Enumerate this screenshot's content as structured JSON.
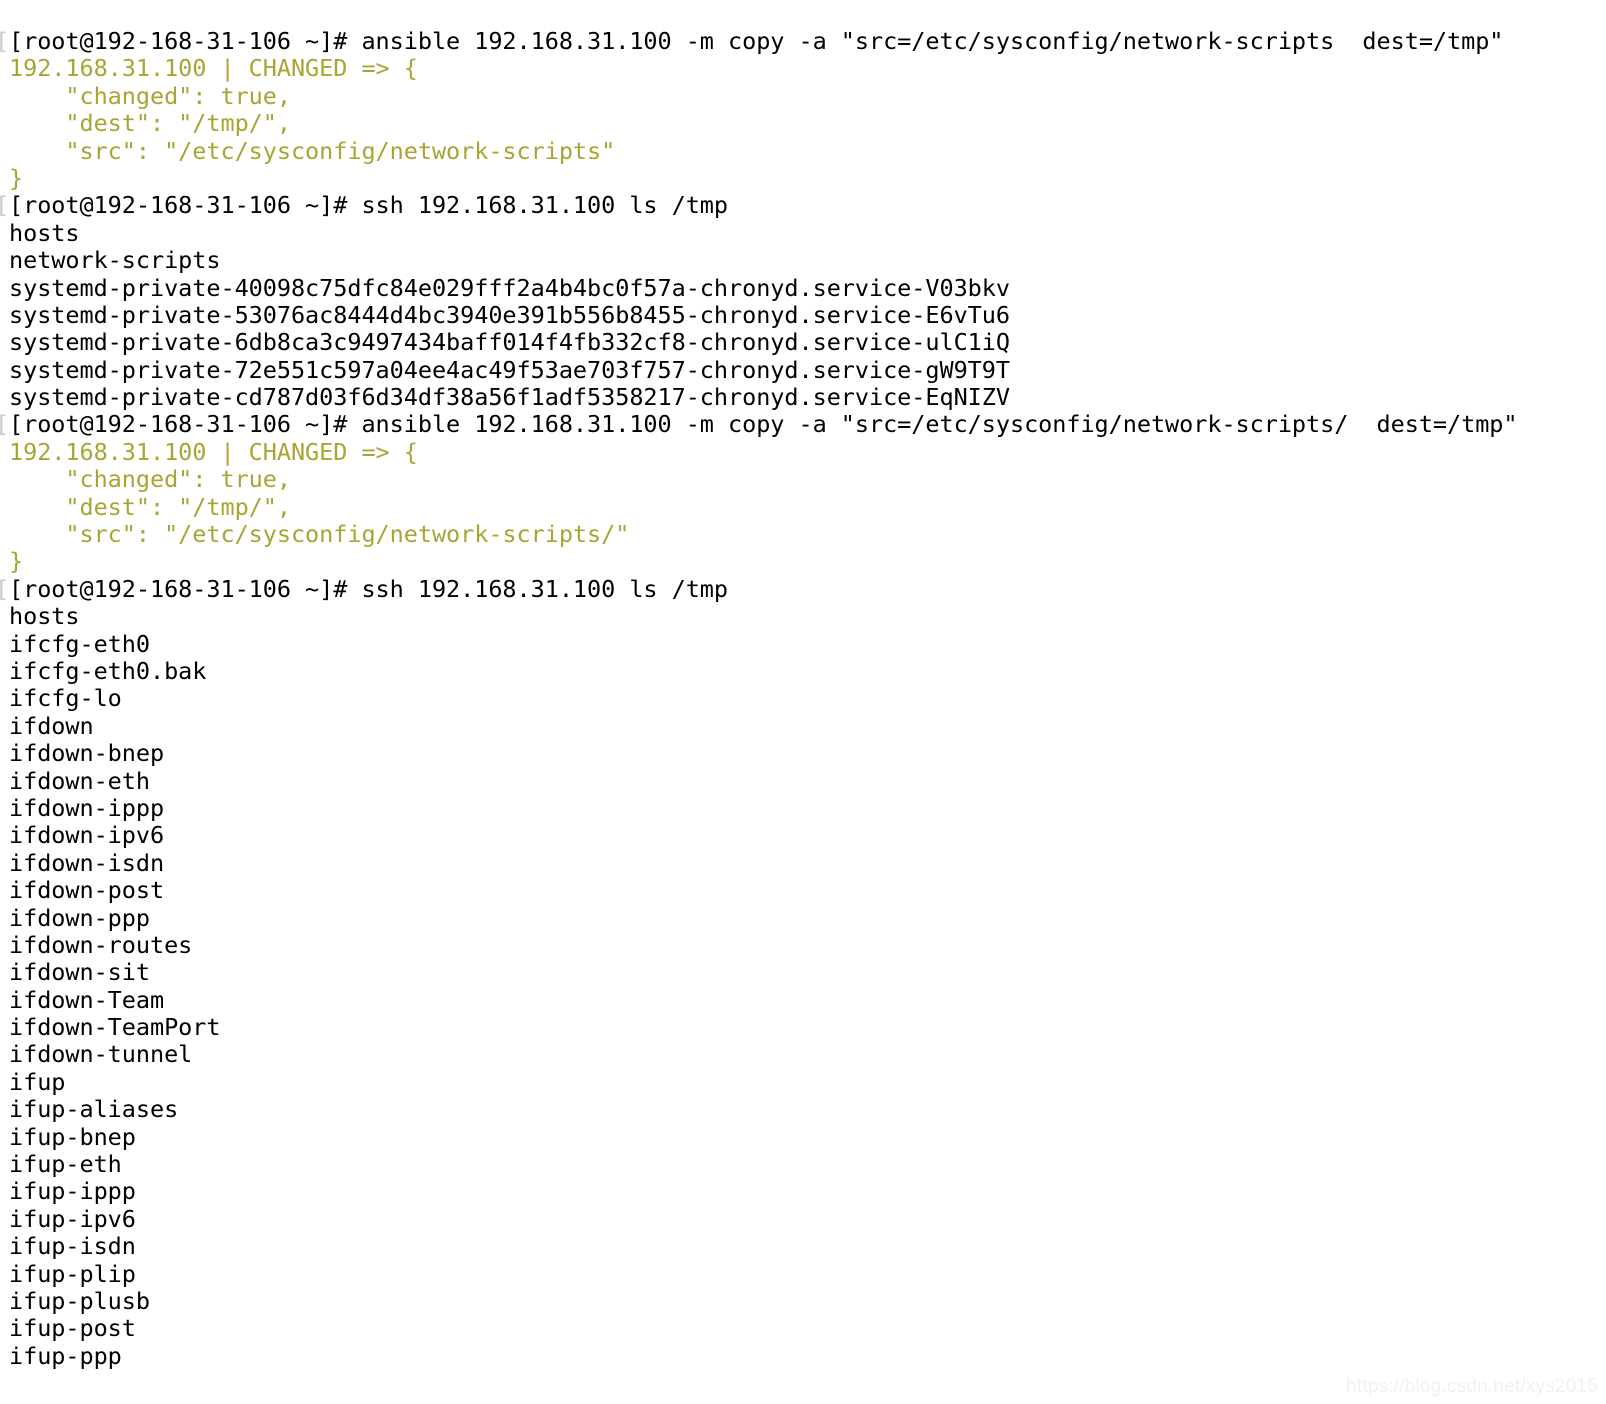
{
  "terminal": {
    "background_color": "#ffffff",
    "default_text_color": "#000000",
    "output_accent_color": "#a9a534",
    "watermark": "https://blog.csdn.net/xys2015",
    "lines": [
      {
        "kind": "prompt",
        "text": "[root@192-168-31-106 ~]# ansible 192.168.31.100 -m copy -a \"src=/etc/sysconfig/network-scripts  dest=/tmp\""
      },
      {
        "kind": "json",
        "text": "192.168.31.100 | CHANGED => {"
      },
      {
        "kind": "json",
        "text": "    \"changed\": true,"
      },
      {
        "kind": "json",
        "text": "    \"dest\": \"/tmp/\","
      },
      {
        "kind": "json",
        "text": "    \"src\": \"/etc/sysconfig/network-scripts\""
      },
      {
        "kind": "json",
        "text": "}"
      },
      {
        "kind": "prompt",
        "text": "[root@192-168-31-106 ~]# ssh 192.168.31.100 ls /tmp"
      },
      {
        "kind": "out",
        "text": "hosts"
      },
      {
        "kind": "out",
        "text": "network-scripts"
      },
      {
        "kind": "out",
        "text": "systemd-private-40098c75dfc84e029fff2a4b4bc0f57a-chronyd.service-V03bkv"
      },
      {
        "kind": "out",
        "text": "systemd-private-53076ac8444d4bc3940e391b556b8455-chronyd.service-E6vTu6"
      },
      {
        "kind": "out",
        "text": "systemd-private-6db8ca3c9497434baff014f4fb332cf8-chronyd.service-ulC1iQ"
      },
      {
        "kind": "out",
        "text": "systemd-private-72e551c597a04ee4ac49f53ae703f757-chronyd.service-gW9T9T"
      },
      {
        "kind": "out",
        "text": "systemd-private-cd787d03f6d34df38a56f1adf5358217-chronyd.service-EqNIZV"
      },
      {
        "kind": "prompt",
        "text": "[root@192-168-31-106 ~]# ansible 192.168.31.100 -m copy -a \"src=/etc/sysconfig/network-scripts/  dest=/tmp\""
      },
      {
        "kind": "json",
        "text": "192.168.31.100 | CHANGED => {"
      },
      {
        "kind": "json",
        "text": "    \"changed\": true,"
      },
      {
        "kind": "json",
        "text": "    \"dest\": \"/tmp/\","
      },
      {
        "kind": "json",
        "text": "    \"src\": \"/etc/sysconfig/network-scripts/\""
      },
      {
        "kind": "json",
        "text": "}"
      },
      {
        "kind": "prompt",
        "text": "[root@192-168-31-106 ~]# ssh 192.168.31.100 ls /tmp"
      },
      {
        "kind": "out",
        "text": "hosts"
      },
      {
        "kind": "out",
        "text": "ifcfg-eth0"
      },
      {
        "kind": "out",
        "text": "ifcfg-eth0.bak"
      },
      {
        "kind": "out",
        "text": "ifcfg-lo"
      },
      {
        "kind": "out",
        "text": "ifdown"
      },
      {
        "kind": "out",
        "text": "ifdown-bnep"
      },
      {
        "kind": "out",
        "text": "ifdown-eth"
      },
      {
        "kind": "out",
        "text": "ifdown-ippp"
      },
      {
        "kind": "out",
        "text": "ifdown-ipv6"
      },
      {
        "kind": "out",
        "text": "ifdown-isdn"
      },
      {
        "kind": "out",
        "text": "ifdown-post"
      },
      {
        "kind": "out",
        "text": "ifdown-ppp"
      },
      {
        "kind": "out",
        "text": "ifdown-routes"
      },
      {
        "kind": "out",
        "text": "ifdown-sit"
      },
      {
        "kind": "out",
        "text": "ifdown-Team"
      },
      {
        "kind": "out",
        "text": "ifdown-TeamPort"
      },
      {
        "kind": "out",
        "text": "ifdown-tunnel"
      },
      {
        "kind": "out",
        "text": "ifup"
      },
      {
        "kind": "out",
        "text": "ifup-aliases"
      },
      {
        "kind": "out",
        "text": "ifup-bnep"
      },
      {
        "kind": "out",
        "text": "ifup-eth"
      },
      {
        "kind": "out",
        "text": "ifup-ippp"
      },
      {
        "kind": "out",
        "text": "ifup-ipv6"
      },
      {
        "kind": "out",
        "text": "ifup-isdn"
      },
      {
        "kind": "out",
        "text": "ifup-plip"
      },
      {
        "kind": "out",
        "text": "ifup-plusb"
      },
      {
        "kind": "out",
        "text": "ifup-post"
      },
      {
        "kind": "out",
        "text": "ifup-ppp"
      }
    ]
  }
}
